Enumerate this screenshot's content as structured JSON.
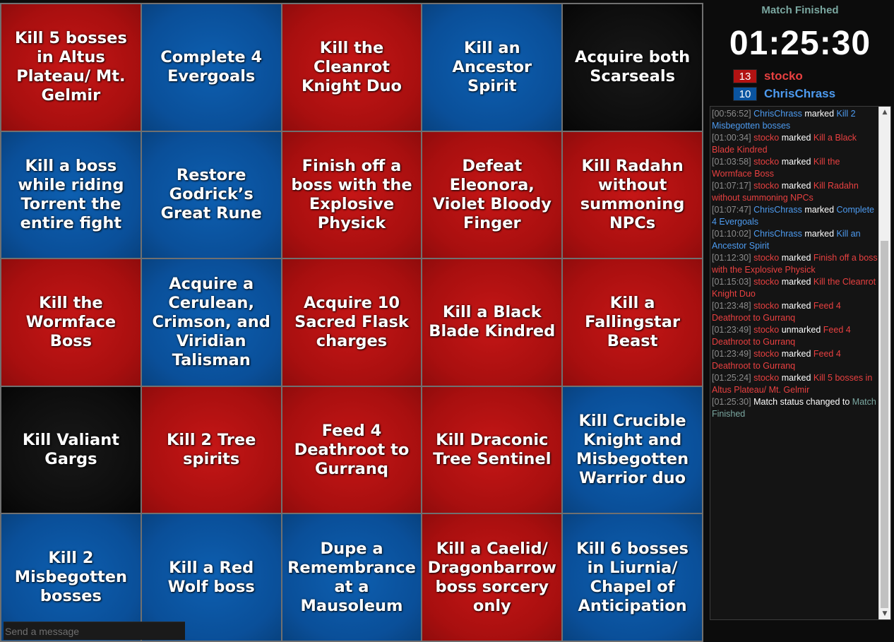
{
  "colors": {
    "red": "#b21212",
    "blue": "#0a54a0",
    "black": "#111111",
    "status_teal": "#7aa7a0",
    "name_red": "#e84040",
    "name_blue": "#4d9bf0"
  },
  "board": {
    "cells": [
      {
        "text": "Kill 5 bosses in Altus Plateau/ Mt. Gelmir",
        "color": "red"
      },
      {
        "text": "Complete 4 Evergoals",
        "color": "blue"
      },
      {
        "text": "Kill the Cleanrot Knight Duo",
        "color": "red"
      },
      {
        "text": "Kill an Ancestor Spirit",
        "color": "blue"
      },
      {
        "text": "Acquire both Scarseals",
        "color": "black"
      },
      {
        "text": "Kill a boss while riding Torrent the entire fight",
        "color": "blue"
      },
      {
        "text": "Restore Godrick’s Great Rune",
        "color": "blue"
      },
      {
        "text": "Finish off a boss with the Explosive Physick",
        "color": "red"
      },
      {
        "text": "Defeat Eleonora, Violet Bloody Finger",
        "color": "red"
      },
      {
        "text": "Kill Radahn without summoning NPCs",
        "color": "red"
      },
      {
        "text": "Kill the Wormface Boss",
        "color": "red"
      },
      {
        "text": "Acquire a Cerulean, Crimson, and Viridian Talisman",
        "color": "blue"
      },
      {
        "text": "Acquire 10 Sacred Flask charges",
        "color": "red"
      },
      {
        "text": "Kill a Black Blade Kindred",
        "color": "red"
      },
      {
        "text": "Kill a Fallingstar Beast",
        "color": "red"
      },
      {
        "text": "Kill Valiant Gargs",
        "color": "black"
      },
      {
        "text": "Kill 2 Tree spirits",
        "color": "red"
      },
      {
        "text": "Feed 4 Deathroot to Gurranq",
        "color": "red"
      },
      {
        "text": "Kill Draconic Tree Sentinel",
        "color": "red"
      },
      {
        "text": "Kill Crucible Knight and Misbegotten Warrior duo",
        "color": "blue"
      },
      {
        "text": "Kill 2 Misbegotten bosses",
        "color": "blue"
      },
      {
        "text": "Kill a Red Wolf boss",
        "color": "blue"
      },
      {
        "text": "Dupe a Remembrance at a Mausoleum",
        "color": "blue"
      },
      {
        "text": "Kill a Caelid/ Dragonbarrow boss sorcery only",
        "color": "red"
      },
      {
        "text": "Kill 6 bosses in Liurnia/ Chapel of Anticipation",
        "color": "blue"
      }
    ]
  },
  "sidebar": {
    "status": "Match Finished",
    "timer": "01:25:30",
    "players": [
      {
        "score": "13",
        "name": "stocko",
        "color": "red"
      },
      {
        "score": "10",
        "name": "ChrisChrass",
        "color": "blue"
      }
    ]
  },
  "chat": {
    "messages": [
      {
        "ts": "[00:56:52]",
        "player": "ChrisChrass",
        "team": "blue",
        "action": "marked",
        "goal": "Kill 2 Misbegotten bosses"
      },
      {
        "ts": "[01:00:34]",
        "player": "stocko",
        "team": "red",
        "action": "marked",
        "goal": "Kill a Black Blade Kindred"
      },
      {
        "ts": "[01:03:58]",
        "player": "stocko",
        "team": "red",
        "action": "marked",
        "goal": "Kill the Wormface Boss"
      },
      {
        "ts": "[01:07:17]",
        "player": "stocko",
        "team": "red",
        "action": "marked",
        "goal": "Kill Radahn without summoning NPCs"
      },
      {
        "ts": "[01:07:47]",
        "player": "ChrisChrass",
        "team": "blue",
        "action": "marked",
        "goal": "Complete 4 Evergoals"
      },
      {
        "ts": "[01:10:02]",
        "player": "ChrisChrass",
        "team": "blue",
        "action": "marked",
        "goal": "Kill an Ancestor Spirit"
      },
      {
        "ts": "[01:12:30]",
        "player": "stocko",
        "team": "red",
        "action": "marked",
        "goal": "Finish off a boss with the Explosive Physick"
      },
      {
        "ts": "[01:15:03]",
        "player": "stocko",
        "team": "red",
        "action": "marked",
        "goal": "Kill the Cleanrot Knight Duo"
      },
      {
        "ts": "[01:23:48]",
        "player": "stocko",
        "team": "red",
        "action": "marked",
        "goal": "Feed 4 Deathroot to Gurranq"
      },
      {
        "ts": "[01:23:49]",
        "player": "stocko",
        "team": "red",
        "action": "unmarked",
        "goal": "Feed 4 Deathroot to Gurranq"
      },
      {
        "ts": "[01:23:49]",
        "player": "stocko",
        "team": "red",
        "action": "marked",
        "goal": "Feed 4 Deathroot to Gurranq"
      },
      {
        "ts": "[01:25:24]",
        "player": "stocko",
        "team": "red",
        "action": "marked",
        "goal": "Kill 5 bosses in Altus Plateau/ Mt. Gelmir"
      }
    ],
    "system": {
      "ts": "[01:25:30]",
      "text": "Match status changed to",
      "status": "Match Finished"
    },
    "input_placeholder": "Send a message",
    "scroll_up_icon": "triangle-up",
    "scroll_down_icon": "triangle-down"
  }
}
